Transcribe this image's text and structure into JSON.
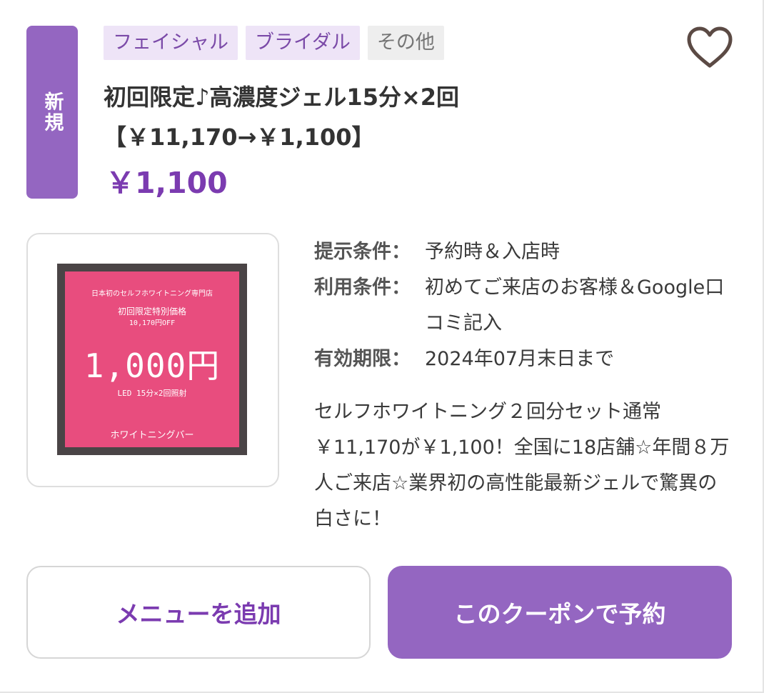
{
  "badge": {
    "label": "新規"
  },
  "tags": [
    {
      "label": "フェイシャル",
      "style": "purple"
    },
    {
      "label": "ブライダル",
      "style": "purple"
    },
    {
      "label": "その他",
      "style": "gray"
    }
  ],
  "coupon": {
    "title": "初回限定♪高濃度ジェル15分×2回【￥11,170→￥1,100】",
    "price": "￥1,100"
  },
  "image": {
    "top_text": "日本初のセルフホワイトニング専門店",
    "sub_text_1": "初回限定特別価格",
    "sub_text_2": "10,170円OFF",
    "big_text": "1,000円",
    "led_text": "LED 15分×2回照射",
    "bottom_text": "ホワイトニングバー"
  },
  "conditions": [
    {
      "label": "提示条件：",
      "value": "予約時＆入店時"
    },
    {
      "label": "利用条件：",
      "value": "初めてご来店のお客様＆Google口コミ記入"
    },
    {
      "label": "有効期限：",
      "value": "2024年07月末日まで"
    }
  ],
  "description": "セルフホワイトニング２回分セット通常￥11,170が￥1,100！全国に18店舗☆年間８万人ご来店☆業界初の高性能最新ジェルで驚異の白さに！",
  "buttons": {
    "add_menu": "メニューを追加",
    "reserve": "このクーポンで予約"
  },
  "colors": {
    "accent": "#9466c1",
    "price": "#7b3bb0",
    "tag_bg": "#eee4f7",
    "image_pink": "#e84d7e"
  },
  "icons": {
    "favorite": "heart-outline-icon"
  }
}
